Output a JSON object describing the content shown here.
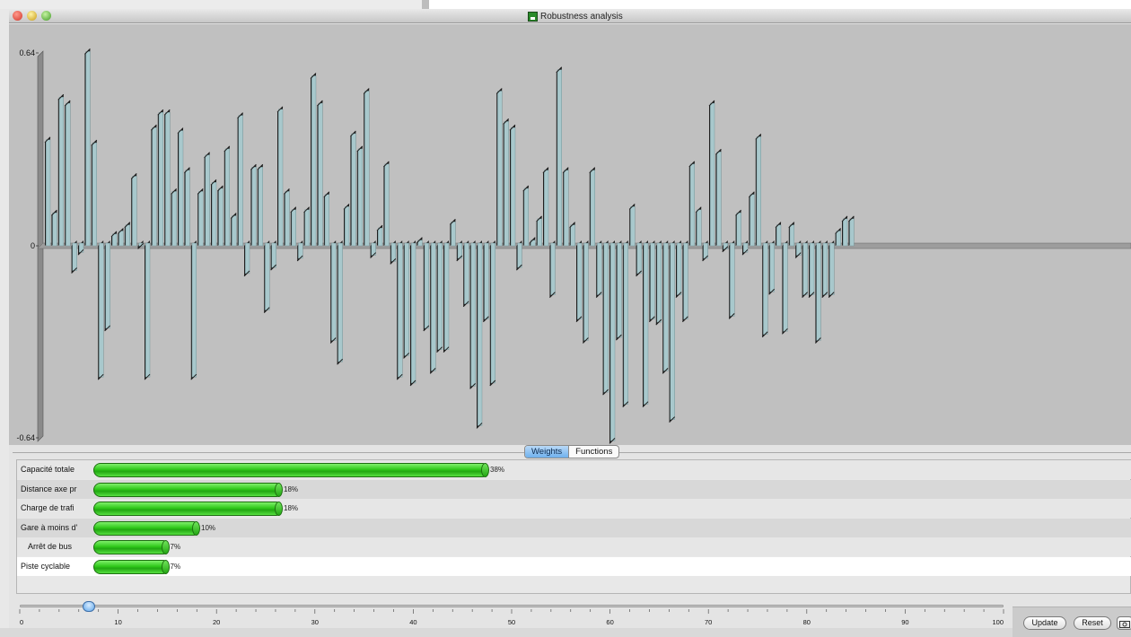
{
  "window": {
    "title": "Robustness analysis"
  },
  "chart_data": {
    "type": "bar",
    "ylim": [
      -0.64,
      0.64
    ],
    "y_tick_labels": [
      "0.64",
      "0",
      "-0.64"
    ],
    "bar_count": 155,
    "values": [
      0.34,
      0.1,
      0.48,
      0.46,
      -0.09,
      -0.03,
      0.63,
      0.33,
      -0.44,
      -0.28,
      0.03,
      0.04,
      0.06,
      0.22,
      -0.01,
      -0.44,
      0.38,
      0.43,
      0.43,
      0.17,
      0.37,
      0.24,
      -0.44,
      0.17,
      0.29,
      0.2,
      0.18,
      0.31,
      0.09,
      0.42,
      -0.1,
      0.25,
      0.25,
      -0.22,
      -0.08,
      0.44,
      0.17,
      0.11,
      -0.05,
      0.11,
      0.55,
      0.46,
      0.16,
      -0.32,
      -0.39,
      0.12,
      0.36,
      0.31,
      0.5,
      -0.04,
      0.05,
      0.26,
      -0.06,
      -0.44,
      -0.37,
      -0.46,
      0.01,
      -0.28,
      -0.42,
      -0.35,
      -0.35,
      0.07,
      -0.05,
      -0.2,
      -0.47,
      -0.6,
      -0.25,
      -0.46,
      0.5,
      0.4,
      0.38,
      -0.08,
      0.18,
      0.01,
      0.08,
      0.24,
      -0.17,
      0.57,
      0.24,
      0.06,
      -0.25,
      -0.32,
      0.24,
      -0.17,
      -0.49,
      -0.65,
      -0.31,
      -0.53,
      0.12,
      -0.1,
      -0.53,
      -0.25,
      -0.26,
      -0.42,
      -0.58,
      -0.17,
      -0.25,
      0.26,
      0.11,
      -0.05,
      0.46,
      0.3,
      -0.02,
      -0.24,
      0.1,
      -0.03,
      0.16,
      0.35,
      -0.3,
      -0.16,
      0.06,
      -0.29,
      0.06,
      -0.04,
      -0.17,
      -0.17,
      -0.32,
      -0.17,
      -0.17,
      0.04,
      0.08,
      0.08
    ]
  },
  "tabs": [
    {
      "label": "Weights",
      "active": true
    },
    {
      "label": "Functions",
      "active": false
    }
  ],
  "weights": [
    {
      "label": "Capacité totale",
      "percent": 38,
      "pct_label": "38%"
    },
    {
      "label": "Distance axe pr",
      "percent": 18,
      "pct_label": "18%"
    },
    {
      "label": "Charge de trafi",
      "percent": 18,
      "pct_label": "18%"
    },
    {
      "label": "Gare à moins d'",
      "percent": 10,
      "pct_label": "10%"
    },
    {
      "label": "Arrêt de bus",
      "percent": 7,
      "pct_label": "7%"
    },
    {
      "label": "Piste cyclable",
      "percent": 7,
      "pct_label": "7%"
    }
  ],
  "slider": {
    "value": 7,
    "min": 0,
    "max": 100,
    "tick_labels": [
      "0",
      "10",
      "20",
      "30",
      "40",
      "50",
      "60",
      "70",
      "80",
      "90",
      "100"
    ]
  },
  "buttons": {
    "update": "Update",
    "reset": "Reset"
  },
  "colors": {
    "bar_fill": "#a8c8cc",
    "bar_edge": "#1b1b1b",
    "chart_bg": "#c0c0c0",
    "weight_bar": "#2fc81a"
  }
}
